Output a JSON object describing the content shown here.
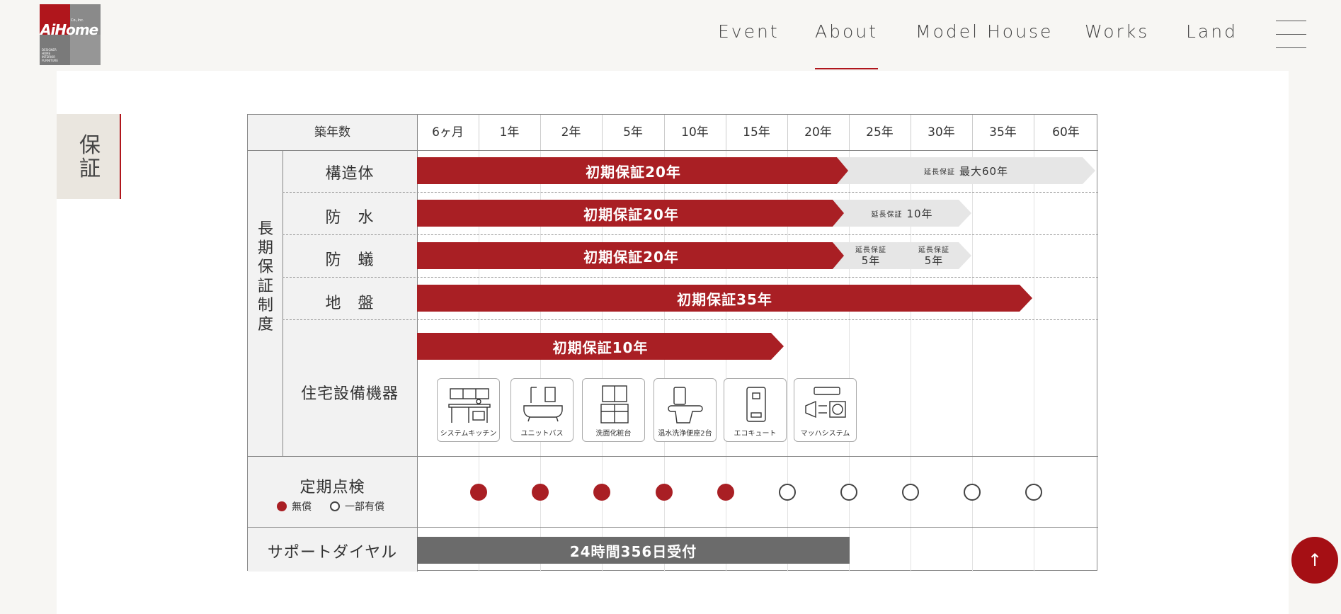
{
  "header": {
    "logo": {
      "mark": "AiHome",
      "company": "Co.,Inc.",
      "tagline": "DESIGNER\nHOME\nINTERIOR\nFURNITURE"
    },
    "nav": [
      {
        "label": "Event",
        "active": false
      },
      {
        "label": "About",
        "active": true
      },
      {
        "label": "Model House",
        "active": false
      },
      {
        "label": "Works",
        "active": false
      },
      {
        "label": "Land",
        "active": false
      }
    ]
  },
  "section_tab": "保証",
  "table": {
    "header_label": "築年数",
    "years": [
      "6ヶ月",
      "1年",
      "2年",
      "5年",
      "10年",
      "15年",
      "20年",
      "25年",
      "30年",
      "35年",
      "60年"
    ],
    "group_label": "長期保証制度",
    "rows": {
      "structure": {
        "label": "構造体",
        "initial": "初期保証20年",
        "ext_small": "延長保証",
        "ext_big": "最大60年"
      },
      "waterproof": {
        "label": "防　水",
        "initial": "初期保証20年",
        "ext_small": "延長保証",
        "ext_big": "10年"
      },
      "termite": {
        "label": "防　蟻",
        "initial": "初期保証20年",
        "ext1_small": "延長保証",
        "ext1_big": "5年",
        "ext2_small": "延長保証",
        "ext2_big": "5年"
      },
      "ground": {
        "label": "地　盤",
        "initial": "初期保証35年"
      },
      "equipment": {
        "label": "住宅設備機器",
        "initial": "初期保証10年",
        "items": [
          {
            "name": "システムキッチン",
            "icon": "kitchen-icon"
          },
          {
            "name": "ユニットバス",
            "icon": "bathtub-icon"
          },
          {
            "name": "洗面化粧台",
            "icon": "vanity-icon"
          },
          {
            "name": "温水洗浄便座2台",
            "icon": "toilet-icon"
          },
          {
            "name": "エコキュート",
            "icon": "water-heater-icon"
          },
          {
            "name": "マッハシステム",
            "icon": "air-system-icon"
          }
        ]
      }
    },
    "inspection": {
      "label": "定期点検",
      "legend_free": "無償",
      "legend_paid": "一部有償",
      "dots": [
        "free",
        "free",
        "free",
        "free",
        "free",
        "paid",
        "paid",
        "paid",
        "paid",
        "paid"
      ]
    },
    "support": {
      "label": "サポートダイヤル",
      "text": "24時間356日受付"
    }
  },
  "colors": {
    "accent": "#a91f24",
    "gray_bar": "#e6e6e6",
    "dark_bar": "#6b6b6b"
  },
  "to_top": "↑"
}
